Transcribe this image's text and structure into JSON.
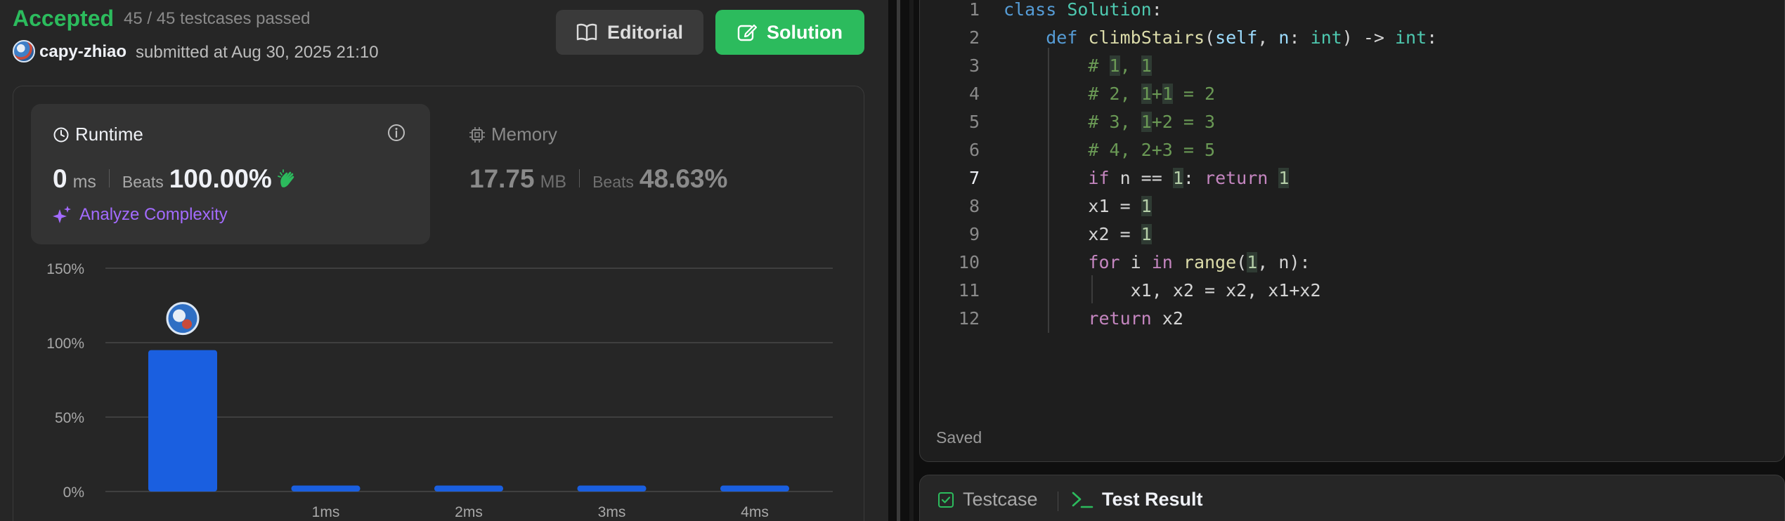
{
  "status": {
    "text": "Accepted",
    "testcases": "45 / 45 testcases passed"
  },
  "submission": {
    "username": "capy-zhiao",
    "submitted_text": "submitted at Aug 30, 2025 21:10"
  },
  "buttons": {
    "editorial": "Editorial",
    "solution": "Solution"
  },
  "runtime": {
    "label": "Runtime",
    "value": "0",
    "unit": "ms",
    "beats_label": "Beats",
    "beats_value": "100.00%",
    "analyze_label": "Analyze Complexity"
  },
  "memory": {
    "label": "Memory",
    "value": "17.75",
    "unit": "MB",
    "beats_label": "Beats",
    "beats_value": "48.63%"
  },
  "chart_data": {
    "type": "bar",
    "categories": [
      "0ms",
      "1ms",
      "2ms",
      "3ms",
      "4ms"
    ],
    "tick_labels": [
      "",
      "1ms",
      "2ms",
      "3ms",
      "4ms"
    ],
    "values": [
      95,
      4,
      4,
      4,
      4
    ],
    "ylim": [
      0,
      150
    ],
    "yticks": [
      0,
      50,
      100,
      150
    ],
    "ytick_labels": [
      "0%",
      "50%",
      "100%",
      "150%"
    ],
    "grid": true,
    "highlight_index": 0,
    "bar_color": "#1a5fe0"
  },
  "editor": {
    "active_line": 7,
    "lines": [
      {
        "n": "1",
        "html": "<span class=\"kw2\">class</span> <span class=\"cls\">Solution</span>:"
      },
      {
        "n": "2",
        "html": "    <span class=\"kw2\">def</span> <span class=\"fn\">climbStairs</span>(<span class=\"prm\">self</span>, <span class=\"prm\">n</span>: <span class=\"typ\">int</span>) -> <span class=\"typ\">int</span>:"
      },
      {
        "n": "3",
        "html": "        <span class=\"cmt\"># <span class=\"hl\">1</span>, <span class=\"hl\">1</span></span>"
      },
      {
        "n": "4",
        "html": "        <span class=\"cmt\"># 2, <span class=\"hl\">1</span>+<span class=\"hl\">1</span> = 2</span>"
      },
      {
        "n": "5",
        "html": "        <span class=\"cmt\"># 3, <span class=\"hl\">1</span>+2 = 3</span>"
      },
      {
        "n": "6",
        "html": "        <span class=\"cmt\"># 4, 2+3 = 5</span>"
      },
      {
        "n": "7",
        "html": "        <span class=\"kw\">if</span> n == <span class=\"num hl\">1</span>: <span class=\"kw\">return</span> <span class=\"num hl\">1</span>"
      },
      {
        "n": "8",
        "html": "        x1 = <span class=\"num hl\">1</span>"
      },
      {
        "n": "9",
        "html": "        x2 = <span class=\"num hl\">1</span>"
      },
      {
        "n": "10",
        "html": "        <span class=\"kw\">for</span> i <span class=\"kw\">in</span> <span class=\"fn\">range</span>(<span class=\"num hl\">1</span>, n):"
      },
      {
        "n": "11",
        "html": "            x1, x2 = x2, x1+x2"
      },
      {
        "n": "12",
        "html": "        <span class=\"kw\">return</span> x2"
      }
    ],
    "saved_text": "Saved"
  },
  "bottom_tabs": {
    "testcase": "Testcase",
    "result": "Test Result"
  },
  "colors": {
    "accepted": "#2cbb5d",
    "solution_button": "#2cbb5d",
    "analyze": "#a36bff",
    "bar": "#1a5fe0"
  }
}
